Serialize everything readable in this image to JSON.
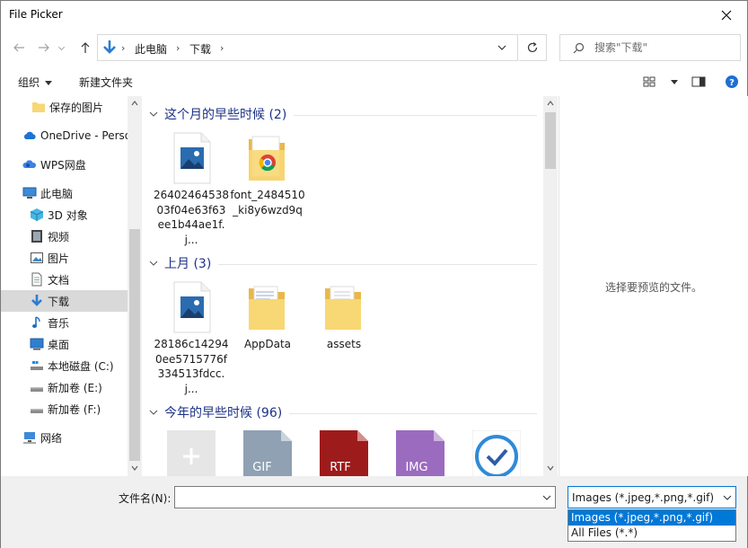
{
  "window": {
    "title": "File Picker"
  },
  "address": {
    "crumbs": [
      "此电脑",
      "下载"
    ],
    "search_placeholder": "搜索\"下载\""
  },
  "toolbar": {
    "organize": "组织",
    "new_folder": "新建文件夹"
  },
  "sidebar": {
    "items": [
      {
        "label": "保存的图片",
        "icon": "folder-icon"
      },
      {
        "label": "OneDrive - Perso",
        "icon": "cloud-icon"
      },
      {
        "label": "WPS网盘",
        "icon": "wps-cloud-icon"
      },
      {
        "label": "此电脑",
        "icon": "computer-icon"
      },
      {
        "label": "3D 对象",
        "icon": "cube-icon"
      },
      {
        "label": "视频",
        "icon": "video-icon"
      },
      {
        "label": "图片",
        "icon": "image-icon"
      },
      {
        "label": "文档",
        "icon": "document-icon"
      },
      {
        "label": "下载",
        "icon": "download-icon",
        "selected": true
      },
      {
        "label": "音乐",
        "icon": "music-icon"
      },
      {
        "label": "桌面",
        "icon": "desktop-icon"
      },
      {
        "label": "本地磁盘 (C:)",
        "icon": "drive-icon"
      },
      {
        "label": "新加卷 (E:)",
        "icon": "drive-icon"
      },
      {
        "label": "新加卷 (F:)",
        "icon": "drive-icon"
      },
      {
        "label": "网络",
        "icon": "network-icon"
      }
    ]
  },
  "groups": [
    {
      "title": "这个月的早些时候 (2)",
      "files": [
        {
          "name": "2640246453803f04e63f63ee1b44ae1f.j...",
          "icon": "image-file-icon"
        },
        {
          "name": "font_2484510_ki8y6wzd9q",
          "icon": "chrome-folder-icon"
        }
      ]
    },
    {
      "title": "上月 (3)",
      "files": [
        {
          "name": "28186c142940ee5715776f334513fdcc.j...",
          "icon": "image-file-icon"
        },
        {
          "name": "AppData",
          "icon": "folder-icon"
        },
        {
          "name": "assets",
          "icon": "folder-icon"
        }
      ]
    },
    {
      "title": "今年的早些时候 (96)",
      "files": [
        {
          "name": "",
          "icon": "plus-file-icon"
        },
        {
          "name": "",
          "icon": "gif-file-icon",
          "tag": "GIF"
        },
        {
          "name": "",
          "icon": "rtf-file-icon",
          "tag": "RTF"
        },
        {
          "name": "",
          "icon": "img-file-icon",
          "tag": "IMG"
        },
        {
          "name": "",
          "icon": "check-circle-icon"
        }
      ]
    }
  ],
  "preview": {
    "text": "选择要预览的文件。"
  },
  "bottom": {
    "filename_label": "文件名(N):",
    "filename_value": "",
    "filetype_selected": "Images (*.jpeg,*.png,*.gif)",
    "filetype_options": [
      "Images (*.jpeg,*.png,*.gif)",
      "All Files (*.*)"
    ]
  },
  "colors": {
    "accent": "#0078d7",
    "group_header": "#1e3287",
    "folder": "#f8d775",
    "image_icon": "#2b6cb0"
  }
}
